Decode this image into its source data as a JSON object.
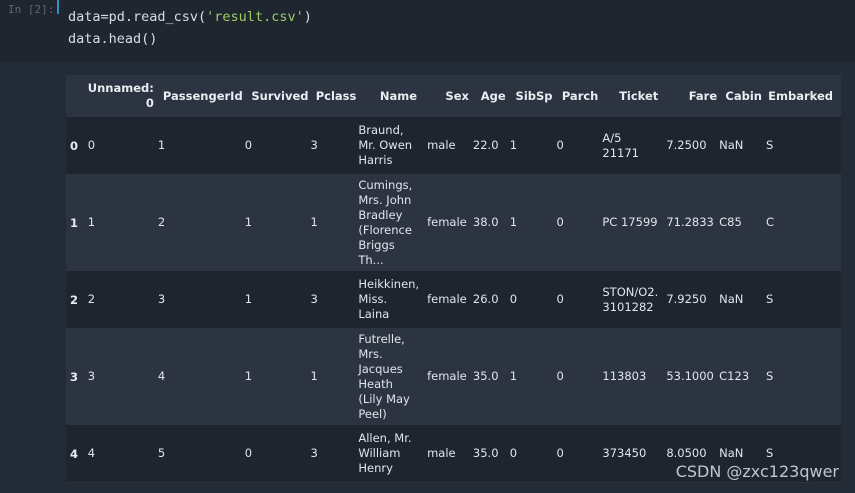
{
  "input_cell": {
    "prompt": "In [2]:",
    "line1_prefix": "data=pd.read_csv(",
    "line1_string": "'result.csv'",
    "line1_suffix": ")",
    "line2": "data.head()"
  },
  "table": {
    "columns": [
      "",
      "Unnamed: 0",
      "PassengerId",
      "Survived",
      "Pclass",
      "Name",
      "Sex",
      "Age",
      "SibSp",
      "Parch",
      "Ticket",
      "Fare",
      "Cabin",
      "Embarked"
    ],
    "rows": [
      {
        "index": "0",
        "cells": [
          "0",
          "1",
          "0",
          "3",
          "Braund, Mr. Owen Harris",
          "male",
          "22.0",
          "1",
          "0",
          "A/5 21171",
          "7.2500",
          "NaN",
          "S"
        ]
      },
      {
        "index": "1",
        "cells": [
          "1",
          "2",
          "1",
          "1",
          "Cumings, Mrs. John Bradley (Florence Briggs Th...",
          "female",
          "38.0",
          "1",
          "0",
          "PC 17599",
          "71.2833",
          "C85",
          "C"
        ]
      },
      {
        "index": "2",
        "cells": [
          "2",
          "3",
          "1",
          "3",
          "Heikkinen, Miss. Laina",
          "female",
          "26.0",
          "0",
          "0",
          "STON/O2. 3101282",
          "7.9250",
          "NaN",
          "S"
        ]
      },
      {
        "index": "3",
        "cells": [
          "3",
          "4",
          "1",
          "1",
          "Futrelle, Mrs. Jacques Heath (Lily May Peel)",
          "female",
          "35.0",
          "1",
          "0",
          "113803",
          "53.1000",
          "C123",
          "S"
        ]
      },
      {
        "index": "4",
        "cells": [
          "4",
          "5",
          "0",
          "3",
          "Allen, Mr. William Henry",
          "male",
          "35.0",
          "0",
          "0",
          "373450",
          "8.0500",
          "NaN",
          "S"
        ]
      }
    ]
  },
  "watermark": "CSDN @zxc123qwer"
}
